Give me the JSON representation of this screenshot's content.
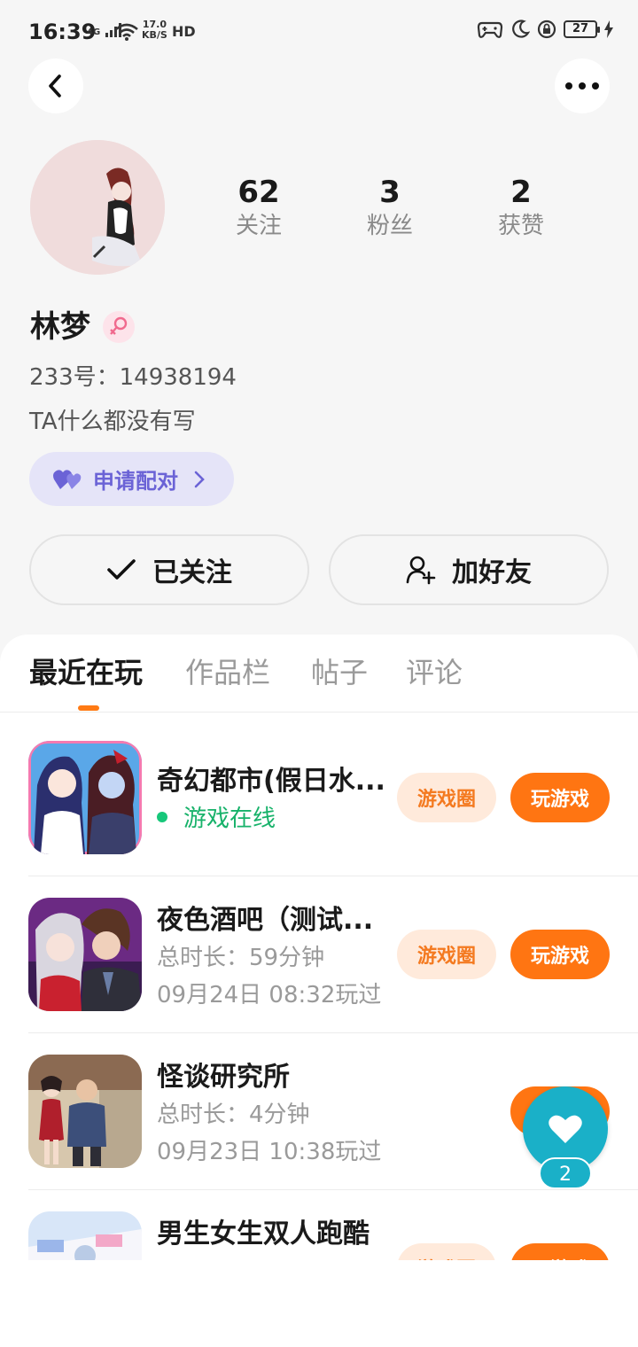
{
  "status_bar": {
    "time": "16:39",
    "network": "4G",
    "speed_value": "17.0",
    "speed_unit": "KB/S",
    "hd": "HD",
    "battery": "27"
  },
  "profile": {
    "stats": [
      {
        "value": "62",
        "label": "关注"
      },
      {
        "value": "3",
        "label": "粉丝"
      },
      {
        "value": "2",
        "label": "获赞"
      }
    ],
    "name": "林梦",
    "gender": "female",
    "uid_text": "233号：14938194",
    "bio": "TA什么都没有写",
    "pair_label": "申请配对",
    "follow_label": "已关注",
    "add_friend_label": "加好友"
  },
  "tabs": [
    "最近在玩",
    "作品栏",
    "帖子",
    "评论"
  ],
  "active_tab": "最近在玩",
  "games": [
    {
      "title": "奇幻都市(假日水...",
      "status": "游戏在线"
    },
    {
      "title": "夜色酒吧（测试...",
      "duration": "总时长：59分钟",
      "last_played": "09月24日 08:32玩过"
    },
    {
      "title": "怪谈研究所",
      "duration": "总时长：4分钟",
      "last_played": "09月23日 10:38玩过"
    },
    {
      "title": "男生女生双人跑酷"
    }
  ],
  "buttons": {
    "circle_label": "游戏圈",
    "play_label": "玩游戏"
  },
  "float_like_count": "2",
  "colors": {
    "accent_orange": "#ff7512",
    "online_green": "#17b26a",
    "pair_purple": "#6b63d6",
    "like_teal": "#1ab0c8"
  }
}
